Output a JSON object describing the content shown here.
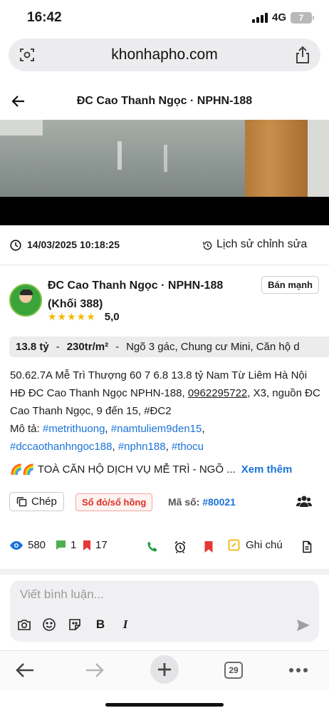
{
  "status_bar": {
    "time": "16:42",
    "network": "4G",
    "battery": "7"
  },
  "browser": {
    "url": "khonhapho.com",
    "tabs_count": "29"
  },
  "header": {
    "title": "ĐC Cao Thanh Ngọc · NPHN-188"
  },
  "meta": {
    "date": "14/03/2025 10:18:25",
    "history_label": "Lịch sử chỉnh sửa"
  },
  "author": {
    "name_line1": "ĐC Cao Thanh Ngọc · NPHN-188",
    "name_line2": "(Khối 388)",
    "stars": "★★★★★",
    "rating": "5,0",
    "tag": "Bán mạnh"
  },
  "price_bar": {
    "price": "13.8 tỷ",
    "price_per_m2": "230tr/m²",
    "features": "Ngõ 3 gác, Chung cư Mini, Căn hộ d"
  },
  "description": {
    "text_part1": "50.62.7A Mễ Trì Thượng 60 7 6.8 13.8 tỷ Nam Từ Liêm Hà Nội HĐ ĐC Cao Thanh Ngọc NPHN-188, ",
    "phone": "0962295722",
    "text_part2": ", X3, nguồn ĐC Cao Thanh Ngọc, 9 đến 15, #ĐC2",
    "mota_label": "Mô tả: ",
    "hashtags": [
      "#metrithuong",
      "#namtuliem9den15",
      "#dccaothanhngoc188",
      "#nphn188",
      "#thocu"
    ],
    "teaser_icons": "🌈🌈",
    "teaser": "TOÀ CĂN HỘ DỊCH VỤ MỄ TRÌ - NGÕ ...",
    "see_more": "Xem thêm"
  },
  "actions": {
    "copy_label": "Chép",
    "doc_badge": "Sổ đỏ/sổ hồng",
    "code_label": "Mã số: ",
    "code_value": "#80021"
  },
  "stats": {
    "views": "580",
    "comments": "1",
    "bookmarks": "17",
    "note_label": "Ghi chú"
  },
  "comment": {
    "placeholder": "Viết bình luận..."
  },
  "colors": {
    "link_blue": "#1a73d9",
    "star_yellow": "#f5b700",
    "badge_red": "#d93025",
    "call_green": "#1e9e3e"
  }
}
